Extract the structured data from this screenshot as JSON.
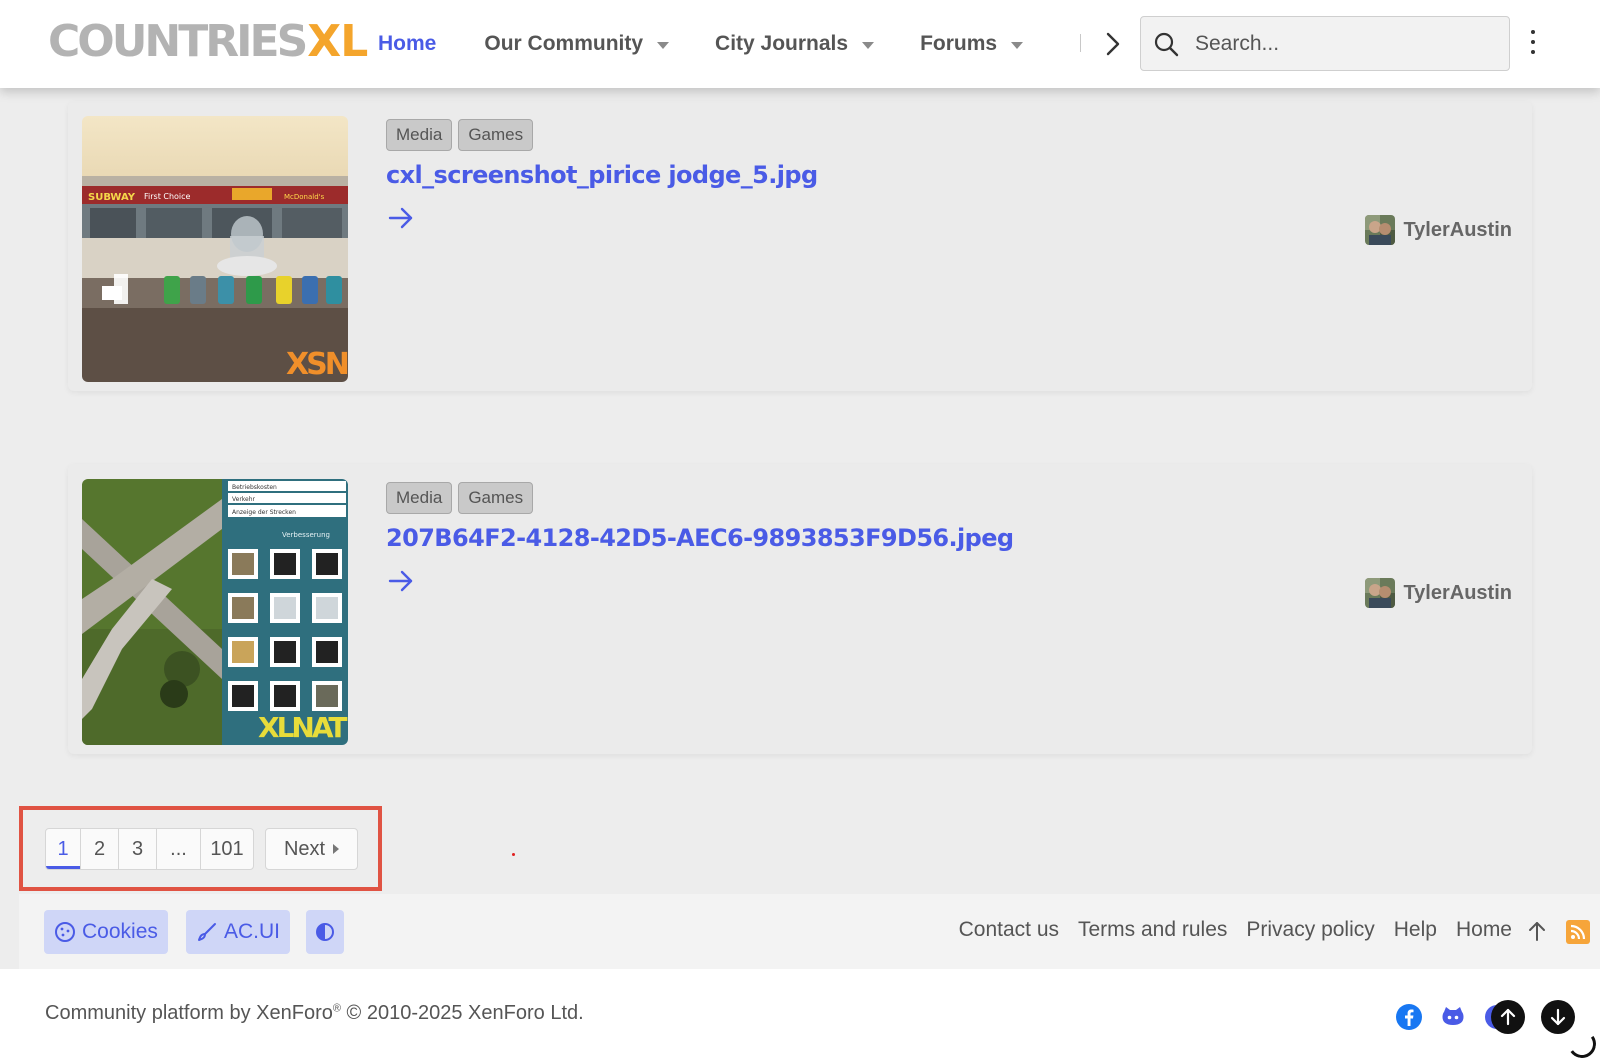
{
  "header": {
    "logo_part1": "COUNTRIES",
    "logo_part2": "XL",
    "nav": [
      {
        "label": "Home",
        "active": true
      },
      {
        "label": "Our Community",
        "dropdown": true
      },
      {
        "label": "City Journals",
        "dropdown": true
      },
      {
        "label": "Forums",
        "dropdown": true
      }
    ],
    "search_placeholder": "Search..."
  },
  "items": [
    {
      "tags": [
        "Media",
        "Games"
      ],
      "title": "cxl_screenshot_pirice jodge_5.jpg",
      "author": "TylerAustin",
      "thumb_sign_texts": [
        "SUBWAY",
        "First Choice",
        "McDonald's"
      ],
      "thumb_watermark": "XSN"
    },
    {
      "tags": [
        "Media",
        "Games"
      ],
      "title": "207B64F2-4128-42D5-AEC6-9893853F9D56.jpeg",
      "author": "TylerAustin",
      "thumb_menu": [
        "Betriebskosten",
        "Verkehr",
        "Anzeige der Strecken"
      ],
      "thumb_panel_title": "Verbesserung",
      "thumb_watermark": "XLNAT"
    }
  ],
  "pagination": {
    "pages": [
      "1",
      "2",
      "3",
      "...",
      "101"
    ],
    "current": "1",
    "next_label": "Next"
  },
  "footer": {
    "buttons": [
      "Cookies",
      "AC.UI"
    ],
    "links": [
      "Contact us",
      "Terms and rules",
      "Privacy policy",
      "Help",
      "Home"
    ],
    "copyright_prefix": "Community platform by XenForo",
    "copyright_mark": "®",
    "copyright_suffix": " © 2010-2025 XenForo Ltd."
  },
  "colors": {
    "accent": "#4a5be6",
    "logo_orange": "#f4a52c",
    "highlight_border": "#e05343",
    "rss": "#f6a53a",
    "facebook": "#1877f2",
    "github": "#4a5be6"
  }
}
